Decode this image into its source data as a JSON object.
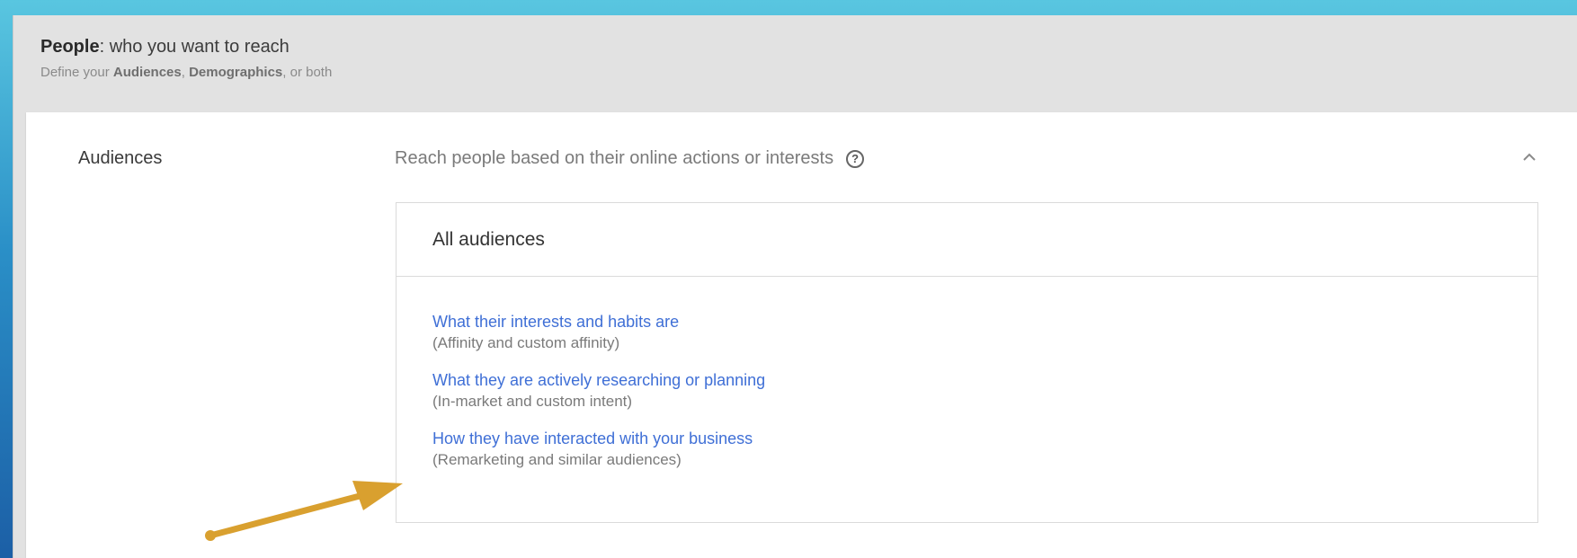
{
  "header": {
    "title_bold": "People",
    "title_rest": ": who you want to reach",
    "subtitle_prefix": "Define your ",
    "subtitle_bold1": "Audiences",
    "subtitle_sep": ", ",
    "subtitle_bold2": "Demographics",
    "subtitle_suffix": ", or both"
  },
  "audiences": {
    "label": "Audiences",
    "description": "Reach people based on their online actions or interests",
    "help_icon": "help-circle-icon",
    "collapse_icon": "chevron-up-icon",
    "panel_title": "All audiences",
    "options": [
      {
        "link": "What their interests and habits are",
        "hint": "(Affinity and custom affinity)"
      },
      {
        "link": "What they are actively researching or planning",
        "hint": "(In-market and custom intent)"
      },
      {
        "link": "How they have interacted with your business",
        "hint": "(Remarketing and similar audiences)"
      }
    ]
  },
  "colors": {
    "link": "#3f6fd6",
    "annotation_arrow": "#d9a02f",
    "frame_background": "#e2e2e2",
    "backdrop": "#2a8fc7"
  },
  "annotation": {
    "icon": "annotation-arrow-icon"
  }
}
